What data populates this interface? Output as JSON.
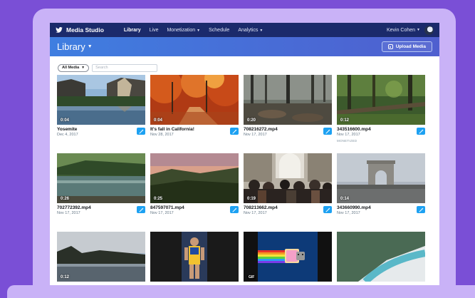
{
  "nav": {
    "brand": "Media Studio",
    "items": [
      {
        "label": "Library",
        "active": true,
        "dropdown": false
      },
      {
        "label": "Live",
        "active": false,
        "dropdown": false
      },
      {
        "label": "Monetization",
        "active": false,
        "dropdown": true
      },
      {
        "label": "Schedule",
        "active": false,
        "dropdown": false
      },
      {
        "label": "Analytics",
        "active": false,
        "dropdown": true
      }
    ],
    "user_name": "Kevin Cohen"
  },
  "header": {
    "title": "Library",
    "upload_label": "Upload Media"
  },
  "filter": {
    "selected": "All Media",
    "search_placeholder": "Search"
  },
  "colors": {
    "nav_bg": "#1b2a6b",
    "header_gradient": [
      "#3f7ee0",
      "#4f5fcf"
    ],
    "accent": "#1da1f2",
    "background": "#7a4fd6",
    "device": "#c9b2f7"
  },
  "media": [
    {
      "title": "Yosemite",
      "date": "Dec 4, 2017",
      "duration": "0:04",
      "thumb": "valley"
    },
    {
      "title": "It's fall in California!",
      "date": "Nov 28, 2017",
      "duration": "0:04",
      "thumb": "autumn"
    },
    {
      "title": "708216272.mp4",
      "date": "Nov 17, 2017",
      "duration": "0:20",
      "thumb": "forest-floor"
    },
    {
      "title": "343516600.mp4",
      "date": "Nov 17, 2017",
      "duration": "0:12",
      "thumb": "green-forest",
      "badge": "MONETIZED"
    },
    {
      "title": "702772392.mp4",
      "date": "Nov 17, 2017",
      "duration": "0:26",
      "thumb": "river"
    },
    {
      "title": "847597071.mp4",
      "date": "Nov 17, 2017",
      "duration": "0:25",
      "thumb": "hills-sunset"
    },
    {
      "title": "708213662.mp4",
      "date": "Nov 17, 2017",
      "duration": "0:19",
      "thumb": "crowd"
    },
    {
      "title": "343660990.mp4",
      "date": "Nov 17, 2017",
      "duration": "0:14",
      "thumb": "arc"
    },
    {
      "title": "",
      "date": "",
      "duration": "0:12",
      "thumb": "lake-dusk"
    },
    {
      "title": "",
      "date": "",
      "duration": "",
      "thumb": "basketball"
    },
    {
      "title": "",
      "date": "",
      "duration": "GIF",
      "thumb": "nyan"
    },
    {
      "title": "",
      "date": "",
      "duration": "",
      "thumb": "fjord"
    }
  ]
}
